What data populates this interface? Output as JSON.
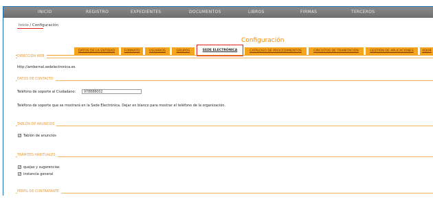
{
  "nav": {
    "items": [
      "INICIO",
      "REGISTRO",
      "EXPEDIENTES",
      "DOCUMENTOS",
      "LIBROS",
      "FIRMAS",
      "TERCEROS"
    ]
  },
  "breadcrumb": {
    "home": "Inicio",
    "separator": "/",
    "current": "Configuración"
  },
  "page_title": "Configuración",
  "tabs": [
    "DATOS DE LA ENTIDAD",
    "FORMATO",
    "USUARIOS",
    "GRUPOS",
    "SEDE ELECTRÓNICA",
    "CATÁLOGO DE PROCEDIMIENTOS",
    "CIRCUITOS DE TRAMITACIÓN",
    "GESTIÓN DE APLICACIONES",
    "ADOR"
  ],
  "active_tab": "SEDE ELECTRÓNICA",
  "sections": {
    "web": {
      "title": "DIRECCIÓN WEB",
      "url": "http://ambernal.sedelectronica.es"
    },
    "contact": {
      "title": "DATOS DE CONTACTO",
      "phone_label": "Teléfono de soporte al Ciudadano:",
      "phone_value": "978888002",
      "help": "Teléfono de soporte que se mostrará en la Sede Electrónica. Dejar en blanco para mostrar el teléfono de la organización."
    },
    "board": {
      "title": "TABLÓN DE ANUNCIOS",
      "checkbox_label": "Tablón de anuncios"
    },
    "procedures": {
      "title": "TRÁMITES HABITUALES",
      "items": [
        "quejas y sugerencias",
        "instancia general"
      ]
    },
    "profile": {
      "title": "PERFIL DE CONTRATANTE"
    }
  },
  "colors": {
    "accent": "#f5a51c",
    "nav_bg": "#7a7a7a",
    "title": "#f08a00",
    "highlight": "#e02020"
  }
}
